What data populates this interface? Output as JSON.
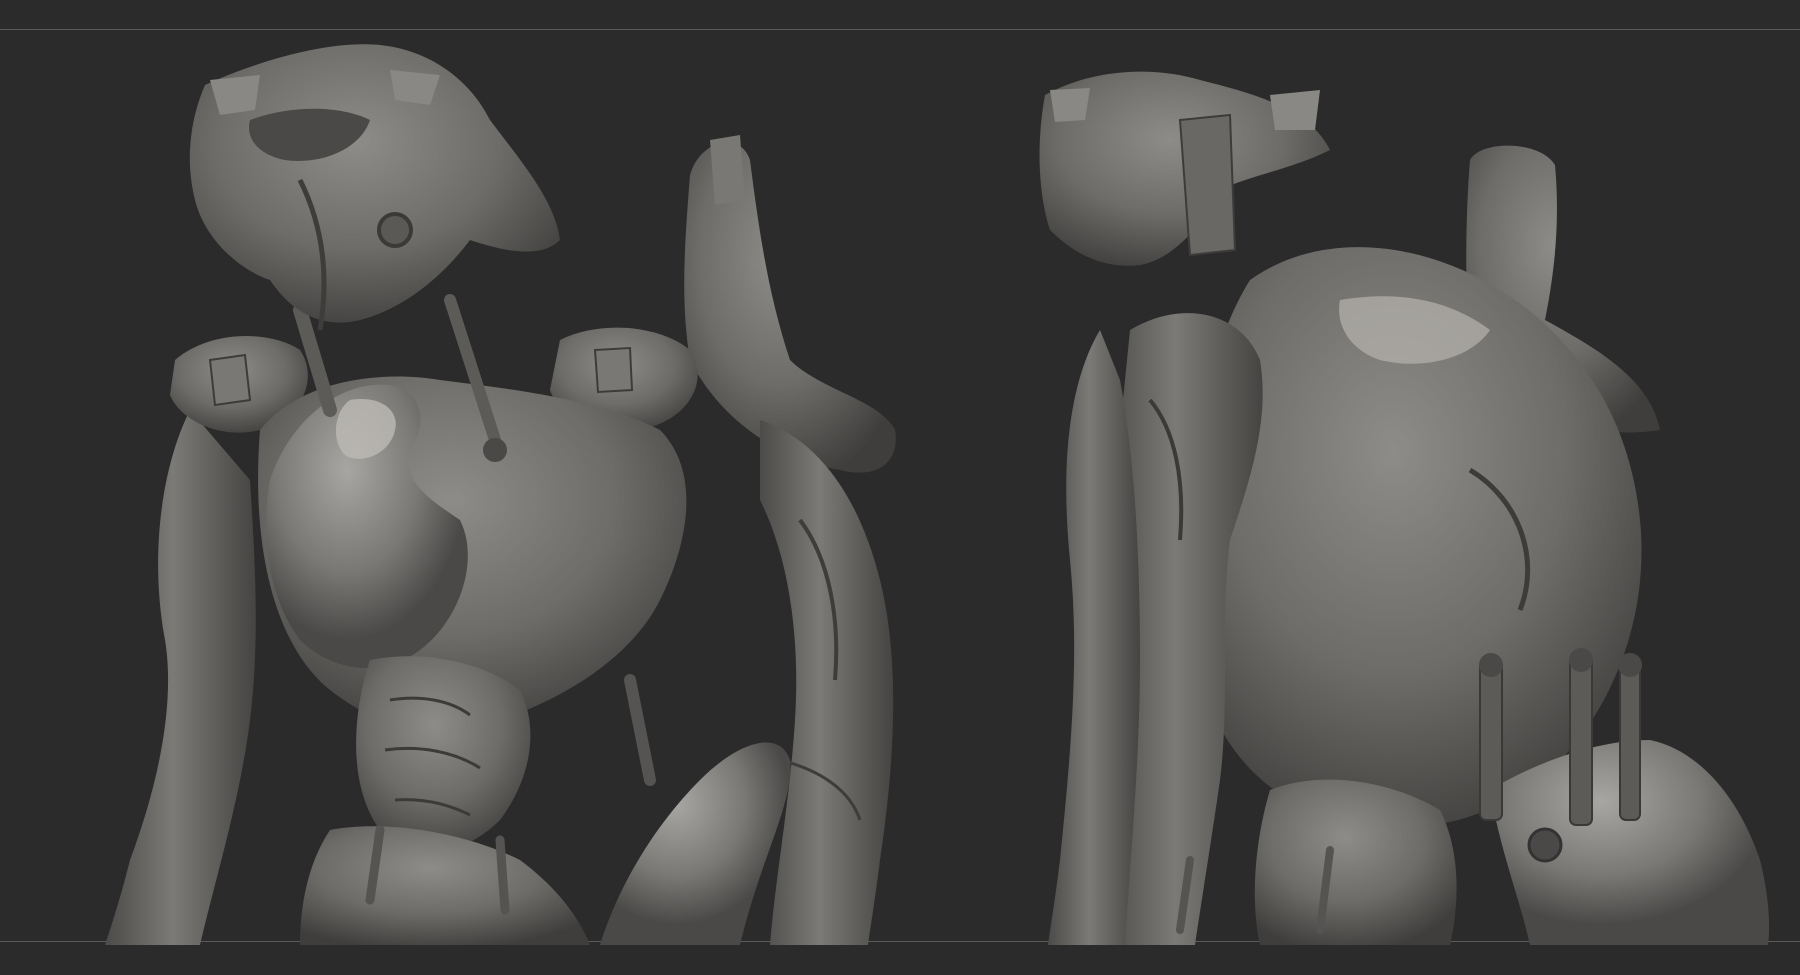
{
  "canvas": {
    "background_color": "#2b2b2b",
    "rule_color": "#5a5a5a"
  },
  "material": {
    "base_color": "#6e6c69",
    "shadow_color": "#3a3937",
    "highlight_color": "#9a9894"
  },
  "views": [
    {
      "label": "",
      "icon": "front-three-quarter-sculpt-view"
    },
    {
      "label": "",
      "icon": "back-three-quarter-sculpt-view"
    }
  ]
}
